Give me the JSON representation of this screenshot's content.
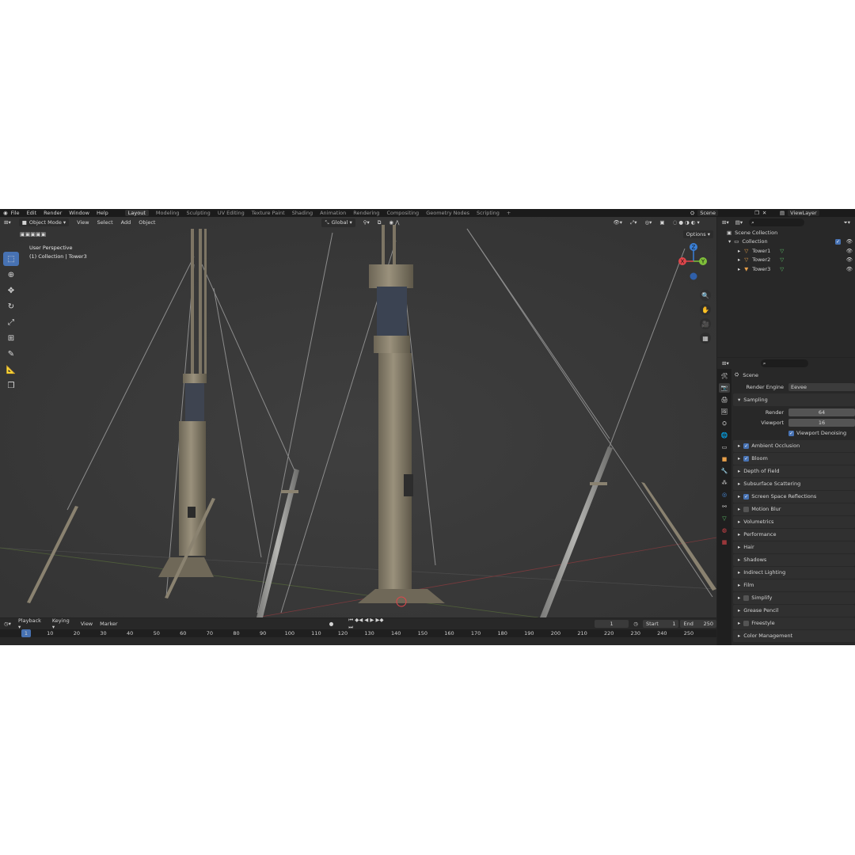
{
  "menu": [
    "File",
    "Edit",
    "Render",
    "Window",
    "Help"
  ],
  "workspaces": [
    "Layout",
    "Modeling",
    "Sculpting",
    "UV Editing",
    "Texture Paint",
    "Shading",
    "Animation",
    "Rendering",
    "Compositing",
    "Geometry Nodes",
    "Scripting"
  ],
  "scene_name": "Scene",
  "view_layer": "ViewLayer",
  "viewport": {
    "mode": "Object Mode",
    "menus": [
      "View",
      "Select",
      "Add",
      "Object"
    ],
    "transform_orientation": "Global",
    "options_label": "Options",
    "info_line1": "User Perspective",
    "info_line2": "(1) Collection | Tower3",
    "axes": [
      "X",
      "Y",
      "Z"
    ]
  },
  "outliner": {
    "root": "Scene Collection",
    "collection": "Collection",
    "objects": [
      "Tower1",
      "Tower2",
      "Tower3"
    ]
  },
  "properties": {
    "context": "Scene",
    "render_engine_label": "Render Engine",
    "render_engine": "Eevee",
    "sampling_label": "Sampling",
    "render_label": "Render",
    "render_samples": "64",
    "viewport_label": "Viewport",
    "viewport_samples": "16",
    "viewport_denoising": "Viewport Denoising",
    "panels": [
      {
        "label": "Ambient Occlusion",
        "checkbox": true,
        "checked": true
      },
      {
        "label": "Bloom",
        "checkbox": true,
        "checked": true
      },
      {
        "label": "Depth of Field",
        "checkbox": false
      },
      {
        "label": "Subsurface Scattering",
        "checkbox": false
      },
      {
        "label": "Screen Space Reflections",
        "checkbox": true,
        "checked": true
      },
      {
        "label": "Motion Blur",
        "checkbox": true,
        "checked": false
      },
      {
        "label": "Volumetrics",
        "checkbox": false
      },
      {
        "label": "Performance",
        "checkbox": false
      },
      {
        "label": "Hair",
        "checkbox": false
      },
      {
        "label": "Shadows",
        "checkbox": false
      },
      {
        "label": "Indirect Lighting",
        "checkbox": false
      },
      {
        "label": "Film",
        "checkbox": false
      },
      {
        "label": "Simplify",
        "checkbox": true,
        "checked": false
      },
      {
        "label": "Grease Pencil",
        "checkbox": false
      },
      {
        "label": "Freestyle",
        "checkbox": true,
        "checked": false
      },
      {
        "label": "Color Management",
        "checkbox": false
      }
    ]
  },
  "timeline": {
    "menus": [
      "Playback",
      "Keying",
      "View",
      "Marker"
    ],
    "current_frame": "1",
    "start_label": "Start",
    "start": "1",
    "end_label": "End",
    "end": "250",
    "ruler": [
      "1",
      "10",
      "20",
      "30",
      "40",
      "50",
      "60",
      "70",
      "80",
      "90",
      "100",
      "110",
      "120",
      "130",
      "140",
      "150",
      "160",
      "170",
      "180",
      "190",
      "200",
      "210",
      "220",
      "230",
      "240",
      "250"
    ]
  },
  "colors": {
    "accent": "#4772b3",
    "axis_x": "#e0464b",
    "axis_y": "#7fbf3a",
    "axis_z": "#3a7fd6"
  }
}
